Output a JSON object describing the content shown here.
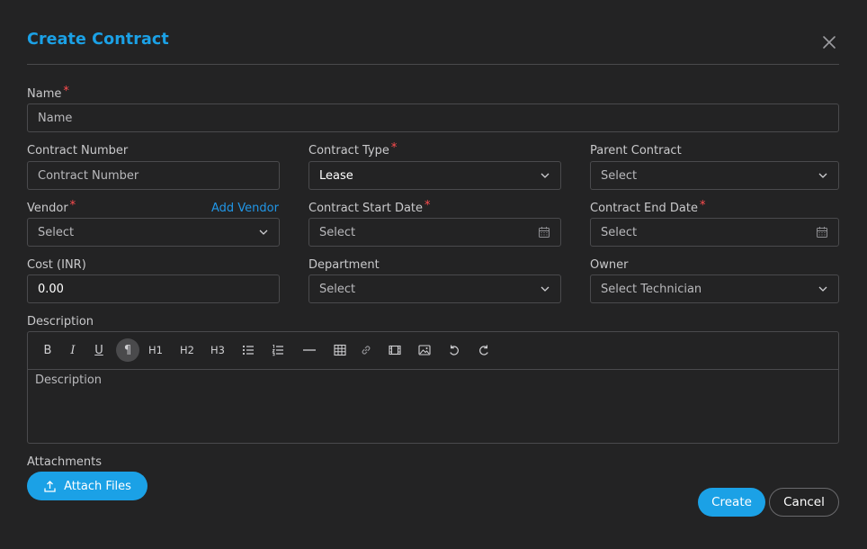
{
  "dialog": {
    "title": "Create Contract",
    "close_icon": "close-icon"
  },
  "fields": {
    "name": {
      "label": "Name",
      "placeholder": "Name",
      "required": "*"
    },
    "contract_number": {
      "label": "Contract Number",
      "placeholder": "Contract Number"
    },
    "contract_type": {
      "label": "Contract Type",
      "value": "Lease",
      "required": "*"
    },
    "parent_contract": {
      "label": "Parent Contract",
      "value": "Select"
    },
    "vendor": {
      "label": "Vendor",
      "value": "Select",
      "required": "*",
      "add_link": "Add Vendor"
    },
    "start_date": {
      "label": "Contract Start Date",
      "value": "Select",
      "required": "*"
    },
    "end_date": {
      "label": "Contract End Date",
      "value": "Select",
      "required": "*"
    },
    "cost": {
      "label": "Cost (INR)",
      "value": "0.00"
    },
    "department": {
      "label": "Department",
      "value": "Select"
    },
    "owner": {
      "label": "Owner",
      "value": "Select Technician"
    }
  },
  "description": {
    "label": "Description",
    "placeholder": "Description",
    "toolbar": {
      "bold": "B",
      "italic": "I",
      "underline": "U",
      "paragraph": "¶",
      "h1": "H1",
      "h2": "H2",
      "h3": "H3"
    }
  },
  "attachments": {
    "label": "Attachments",
    "button": "Attach Files"
  },
  "actions": {
    "create": "Create",
    "cancel": "Cancel"
  },
  "colors": {
    "background": "#232324",
    "accent": "#1ba1e6",
    "required": "#ff4d4f",
    "border": "#4a4a4d"
  }
}
